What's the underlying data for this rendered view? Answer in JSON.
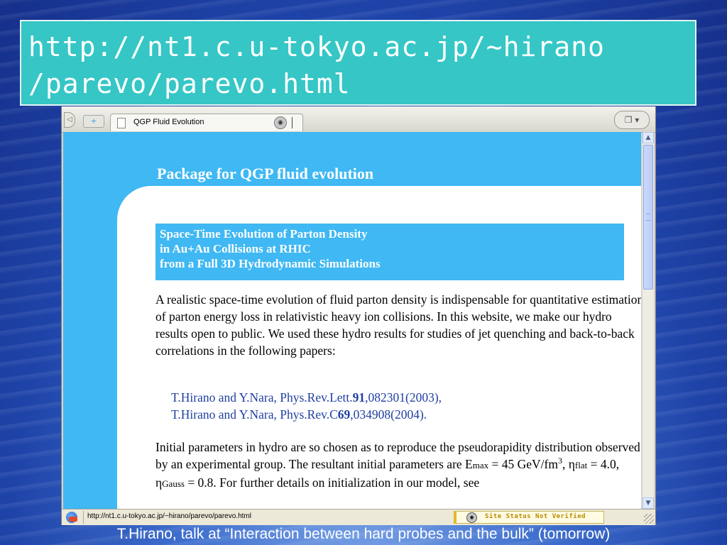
{
  "banner": {
    "url_line1": "http://nt1.c.u-tokyo.ac.jp/~hirano",
    "url_line2": "/parevo/parevo.html"
  },
  "browser": {
    "tab_title": "QGP Fluid Evolution",
    "icons": {
      "tab_left": "left-arrow-icon",
      "new_tab": "new-tab-icon",
      "page": "page-icon",
      "shield": "shield-icon",
      "tab_list": "tab-list-icon"
    }
  },
  "page": {
    "heading": "Package for QGP fluid evolution",
    "subtitle_lines": [
      "Space-Time Evolution of Parton Density",
      "in Au+Au Collisions at RHIC",
      "from a Full 3D Hydrodynamic Simulations"
    ],
    "para1": "A realistic space-time evolution of fluid parton density is indispensable for quantitative estimation of parton energy loss in relativistic heavy ion collisions. In this website, we make our hydro results open to public. We used these hydro results for studies of jet quenching and back-to-back correlations in the following papers:",
    "refs": [
      {
        "prefix": "T.Hirano and Y.Nara, Phys.Rev.Lett.",
        "volume": "91",
        "suffix": ",082301(2003),"
      },
      {
        "prefix": "T.Hirano and Y.Nara, Phys.Rev.C",
        "volume": "69",
        "suffix": ",034908(2004)."
      }
    ],
    "para2": {
      "text": "Initial parameters in hydro are so chosen as to reproduce the pseudorapidity distribution observed by an experimental group. The resultant initial parameters are ",
      "e_label": "E",
      "e_sub": "max",
      "e_value": " = 45 GeV/fm",
      "e_sup": "3",
      "eta_flat_label": ", η",
      "eta_flat_sub": "flat",
      "eta_flat_value": " = 4.0, η",
      "eta_gauss_sub": "Gauss",
      "eta_gauss_value": " = 0.8. For further details on initialization in our model, see"
    }
  },
  "statusbar": {
    "url": "http://nt1.c.u-tokyo.ac.jp/~hirano/parevo/parevo.html",
    "site_status": "Site Status Not Verified"
  },
  "caption": "T.Hirano, talk at “Interaction between hard probes and the bulk” (tomorrow)"
}
